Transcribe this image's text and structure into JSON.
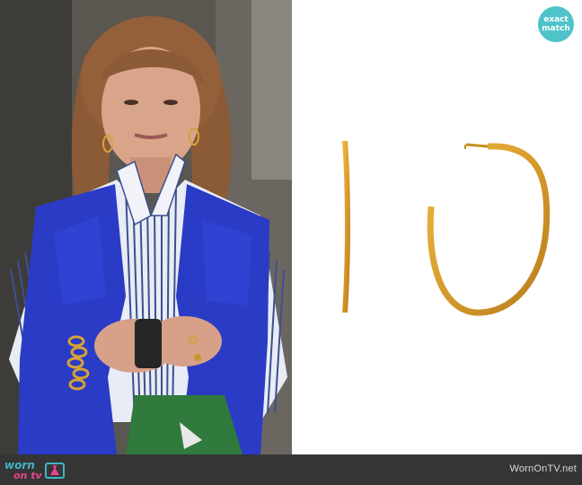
{
  "photo": {
    "description_icon": "woman-in-blue-vest-photo",
    "watermark": "wornontv.net"
  },
  "product": {
    "item_icon": "gold-hoop-earrings"
  },
  "badge": {
    "line1": "exact",
    "line2": "match",
    "color": "#4ec3c9"
  },
  "footer": {
    "logo_worn": "worn",
    "logo_ontv": "on tv",
    "site_name": "WornOnTV.net",
    "background": "#353535"
  }
}
